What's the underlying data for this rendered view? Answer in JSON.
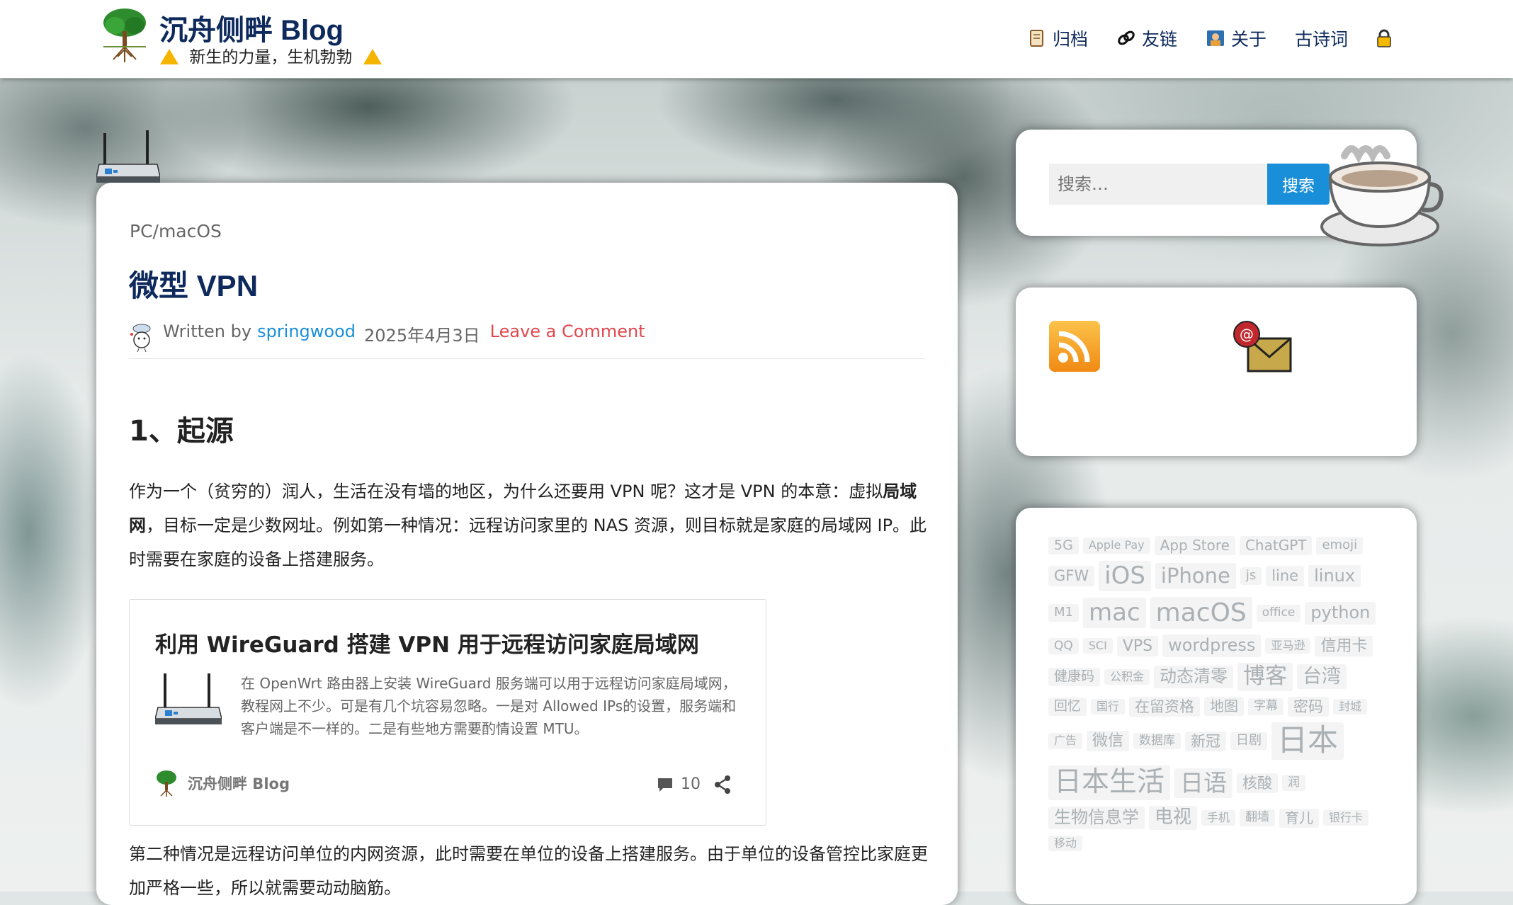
{
  "site": {
    "title": "沉舟侧畔 Blog",
    "tagline": "新生的力量，生机勃勃"
  },
  "nav": [
    {
      "label": "归档",
      "icon": "scroll-icon"
    },
    {
      "label": "友链",
      "icon": "link-icon"
    },
    {
      "label": "关于",
      "icon": "photo-icon"
    },
    {
      "label": "古诗词",
      "icon": ""
    },
    {
      "label": "",
      "icon": "lock-icon"
    }
  ],
  "post": {
    "category": "PC/macOS",
    "title": "微型 VPN",
    "meta": {
      "written_by": "Written by",
      "author": "springwood",
      "date": "2025年4月3日",
      "comment_link": "Leave a Comment"
    },
    "section_heading": "1、起源",
    "para1_a": "作为一个（贫穷的）润人，生活在没有墙的地区，为什么还要用 VPN 呢？这才是 VPN 的本意：虚拟",
    "para1_bold": "局域网",
    "para1_b": "，目标一定是少数网址。例如第一种情况：远程访问家里的 NAS 资源，则目标就是家庭的局域网 IP。此时需要在家庭的设备上搭建服务。",
    "para2": "第二种情况是远程访问单位的内网资源，此时需要在单位的设备上搭建服务。由于单位的设备管控比家庭更加严格一些，所以就需要动动脑筋。",
    "embed": {
      "title": "利用 WireGuard 搭建 VPN 用于远程访问家庭局域网",
      "excerpt": "在 OpenWrt 路由器上安装 WireGuard 服务端可以用于远程访问家庭局域网，教程网上不少。可是有几个坑容易忽略。一是对 Allowed IPs的设置，服务端和客户端是不一样的。二是有些地方需要酌情设置 MTU。",
      "site_name": "沉舟侧畔 Blog",
      "comment_count": "10"
    }
  },
  "search": {
    "placeholder": "搜索…",
    "button": "搜索"
  },
  "tags": [
    {
      "t": "5G",
      "s": 19
    },
    {
      "t": "Apple Pay",
      "s": 16
    },
    {
      "t": "App Store",
      "s": 20
    },
    {
      "t": "ChatGPT",
      "s": 20
    },
    {
      "t": "emoji",
      "s": 18
    },
    {
      "t": "GFW",
      "s": 21
    },
    {
      "t": "iOS",
      "s": 34
    },
    {
      "t": "iPhone",
      "s": 29
    },
    {
      "t": "js",
      "s": 18
    },
    {
      "t": "line",
      "s": 21
    },
    {
      "t": "linux",
      "s": 24
    },
    {
      "t": "M1",
      "s": 18
    },
    {
      "t": "mac",
      "s": 34
    },
    {
      "t": "macOS",
      "s": 36
    },
    {
      "t": "office",
      "s": 17
    },
    {
      "t": "python",
      "s": 24
    },
    {
      "t": "QQ",
      "s": 17
    },
    {
      "t": "SCI",
      "s": 16
    },
    {
      "t": "VPS",
      "s": 22
    },
    {
      "t": "wordpress",
      "s": 24
    },
    {
      "t": "亚马逊",
      "s": 16
    },
    {
      "t": "信用卡",
      "s": 22
    },
    {
      "t": "健康码",
      "s": 19
    },
    {
      "t": "公积金",
      "s": 16
    },
    {
      "t": "动态清零",
      "s": 24
    },
    {
      "t": "博客",
      "s": 31
    },
    {
      "t": "台湾",
      "s": 27
    },
    {
      "t": "回忆",
      "s": 19
    },
    {
      "t": "国行",
      "s": 16
    },
    {
      "t": "在留资格",
      "s": 21
    },
    {
      "t": "地图",
      "s": 20
    },
    {
      "t": "字幕",
      "s": 17
    },
    {
      "t": "密码",
      "s": 21
    },
    {
      "t": "封城",
      "s": 16
    },
    {
      "t": "广告",
      "s": 16
    },
    {
      "t": "微信",
      "s": 22
    },
    {
      "t": "数据库",
      "s": 17
    },
    {
      "t": "新冠",
      "s": 21
    },
    {
      "t": "日剧",
      "s": 18
    },
    {
      "t": "日本",
      "s": 43
    },
    {
      "t": "日本生活",
      "s": 39
    },
    {
      "t": "日语",
      "s": 33
    },
    {
      "t": "核酸",
      "s": 21
    },
    {
      "t": "润",
      "s": 17
    },
    {
      "t": "生物信息学",
      "s": 24
    },
    {
      "t": "电视",
      "s": 26
    },
    {
      "t": "手机",
      "s": 16
    },
    {
      "t": "翻墙",
      "s": 17
    },
    {
      "t": "育儿",
      "s": 20
    },
    {
      "t": "银行卡",
      "s": 16
    },
    {
      "t": "移动",
      "s": 16
    }
  ],
  "colors": {
    "title": "#0e2a5c",
    "link": "#1a8fd9",
    "comment_link": "#e0484e",
    "search_button": "#1a8fd9"
  }
}
